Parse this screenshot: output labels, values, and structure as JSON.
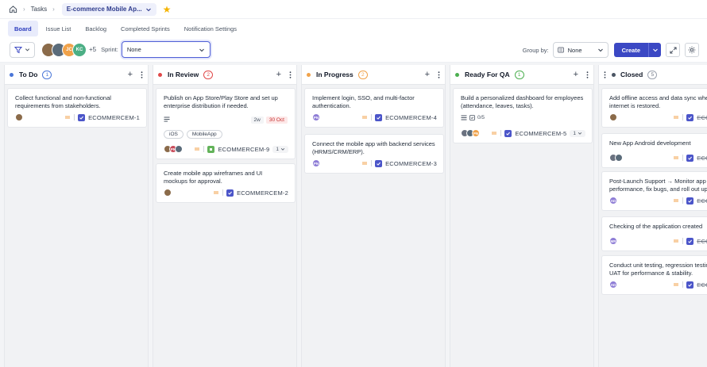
{
  "breadcrumb": {
    "tasks": "Tasks",
    "project": "E-commerce Mobile Ap..."
  },
  "tabs": [
    {
      "label": "Board",
      "active": true
    },
    {
      "label": "Issue List",
      "active": false
    },
    {
      "label": "Backlog",
      "active": false
    },
    {
      "label": "Completed Sprints",
      "active": false
    },
    {
      "label": "Notification Settings",
      "active": false
    }
  ],
  "toolbar": {
    "avatars": [
      {
        "initials": "",
        "color": "#8b6b4a"
      },
      {
        "initials": "",
        "color": "#5a6b7a"
      },
      {
        "initials": "JC",
        "color": "#f0a24a"
      },
      {
        "initials": "KC",
        "color": "#4caf85"
      }
    ],
    "more_count": "+5",
    "sprint_label": "Sprint:",
    "sprint_value": "None",
    "groupby_label": "Group by:",
    "groupby_value": "None",
    "create_label": "Create"
  },
  "columns": [
    {
      "title": "To Do",
      "count": "1",
      "dot": "#4a76d8",
      "badge": "#4a76d8",
      "cards": [
        {
          "title": "Collect functional and non-functional requirements from stakeholders.",
          "key": "ECOMMERCEM-1"
        }
      ]
    },
    {
      "title": "In Review",
      "count": "2",
      "dot": "#e04848",
      "badge": "#e04848",
      "cards": [
        {
          "title": "Publish on App Store/Play Store and set up enterprise distribution if needed.",
          "estimate": "2w",
          "due": "30 Oct",
          "tags": [
            "iOS",
            "MobileApp"
          ],
          "key": "ECOMMERCEM-9",
          "points": "1"
        },
        {
          "title": "Create mobile app wireframes and UI mockups for approval.",
          "key": "ECOMMERCEM-2"
        }
      ]
    },
    {
      "title": "In Progress",
      "count": "2",
      "dot": "#f0a24a",
      "badge": "#f0a24a",
      "cards": [
        {
          "title": "Implement login, SSO, and multi-factor authentication.",
          "key": "ECOMMERCEM-4",
          "avatar": "PN"
        },
        {
          "title": "Connect the mobile app with backend services (HRMS/CRM/ERP).",
          "key": "ECOMMERCEM-3",
          "avatar": "PN"
        }
      ]
    },
    {
      "title": "Ready For QA",
      "count": "1",
      "dot": "#4caf50",
      "badge": "#4caf50",
      "cards": [
        {
          "title": "Build a personalized dashboard for employees (attendance, leaves, tasks).",
          "subtasks": "0/5",
          "key": "ECOMMERCEM-5",
          "points": "1",
          "avatar": "PN"
        }
      ]
    },
    {
      "title": "Closed",
      "count": "5",
      "dot": "#4b5563",
      "badge": "#6b7280",
      "cards": [
        {
          "title": "Add offline access and data sync whe internet is restored.",
          "key": "ECOMM"
        },
        {
          "title": "New App Android development",
          "key": "ECOMM"
        },
        {
          "title": "Post-Launch Support → Monitor app performance, fix bugs, and roll out up",
          "key": "ECOMM",
          "avatar": "AD"
        },
        {
          "title": "Checking of the application created",
          "key": "ECOMM",
          "avatar": "MR"
        },
        {
          "title": "Conduct unit testing, regression testin UAT for performance & stability.",
          "key": "ECOMM",
          "avatar": "AD"
        }
      ]
    }
  ]
}
